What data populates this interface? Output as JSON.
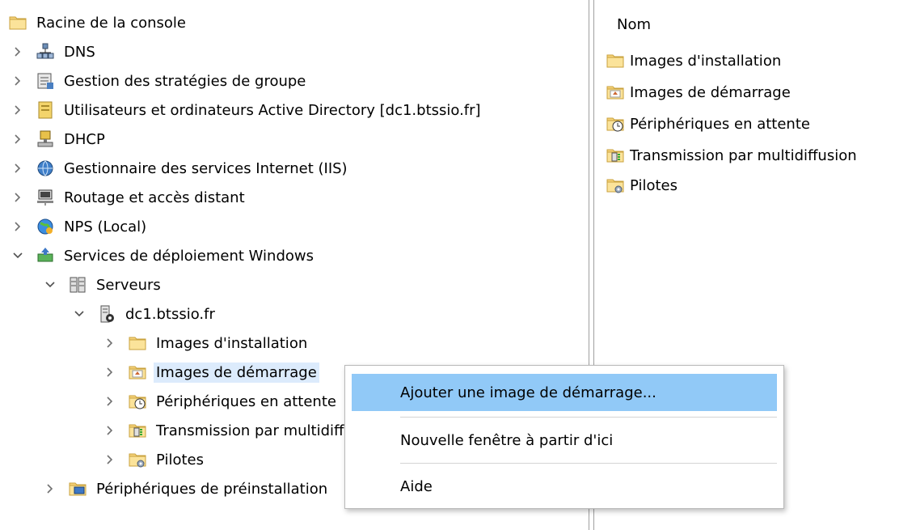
{
  "tree": {
    "root": {
      "label": "Racine de la console",
      "icon": "folder-icon"
    },
    "items": [
      {
        "label": "DNS",
        "icon": "dns-server-icon",
        "expander": "collapsed"
      },
      {
        "label": "Gestion des stratégies de groupe",
        "icon": "group-policy-icon",
        "expander": "collapsed"
      },
      {
        "label": "Utilisateurs et ordinateurs Active Directory [dc1.btssio.fr]",
        "icon": "active-directory-icon",
        "expander": "collapsed"
      },
      {
        "label": "DHCP",
        "icon": "dhcp-icon",
        "expander": "collapsed"
      },
      {
        "label": "Gestionnaire des services Internet (IIS)",
        "icon": "iis-icon",
        "expander": "collapsed"
      },
      {
        "label": "Routage et accès distant",
        "icon": "routing-icon",
        "expander": "collapsed"
      },
      {
        "label": "NPS (Local)",
        "icon": "nps-globe-icon",
        "expander": "collapsed"
      },
      {
        "label": "Services de déploiement Windows",
        "icon": "wds-icon",
        "expander": "expanded"
      },
      {
        "label": "Serveurs",
        "icon": "servers-icon",
        "expander": "expanded"
      },
      {
        "label": "dc1.btssio.fr",
        "icon": "server-icon",
        "expander": "expanded"
      },
      {
        "label": "Images d'installation",
        "icon": "folder-icon",
        "expander": "collapsed"
      },
      {
        "label": "Images de démarrage",
        "icon": "boot-images-folder-icon",
        "expander": "collapsed"
      },
      {
        "label": "Périphériques en attente",
        "icon": "pending-devices-folder-icon",
        "expander": "collapsed"
      },
      {
        "label": "Transmission par multidiffusion",
        "icon": "multicast-folder-icon",
        "expander": "collapsed"
      },
      {
        "label": "Pilotes",
        "icon": "drivers-folder-icon",
        "expander": "collapsed"
      },
      {
        "label": "Périphériques de préinstallation",
        "icon": "prestaged-devices-icon",
        "expander": "collapsed"
      }
    ]
  },
  "right_pane": {
    "column_header": "Nom",
    "items": [
      {
        "label": "Images d'installation",
        "icon": "folder-icon"
      },
      {
        "label": "Images de démarrage",
        "icon": "boot-images-folder-icon"
      },
      {
        "label": "Périphériques en attente",
        "icon": "pending-devices-folder-icon"
      },
      {
        "label": "Transmission par multidiffusion",
        "icon": "multicast-folder-icon"
      },
      {
        "label": "Pilotes",
        "icon": "drivers-folder-icon"
      }
    ]
  },
  "context_menu": {
    "items": [
      {
        "label": "Ajouter une image de démarrage..."
      },
      {
        "label": "Nouvelle fenêtre à partir d'ici"
      },
      {
        "label": "Aide"
      }
    ]
  },
  "colors": {
    "selection": "#dcebfc",
    "menu_hover": "#91c9f7",
    "folder": "#f6d37a"
  }
}
